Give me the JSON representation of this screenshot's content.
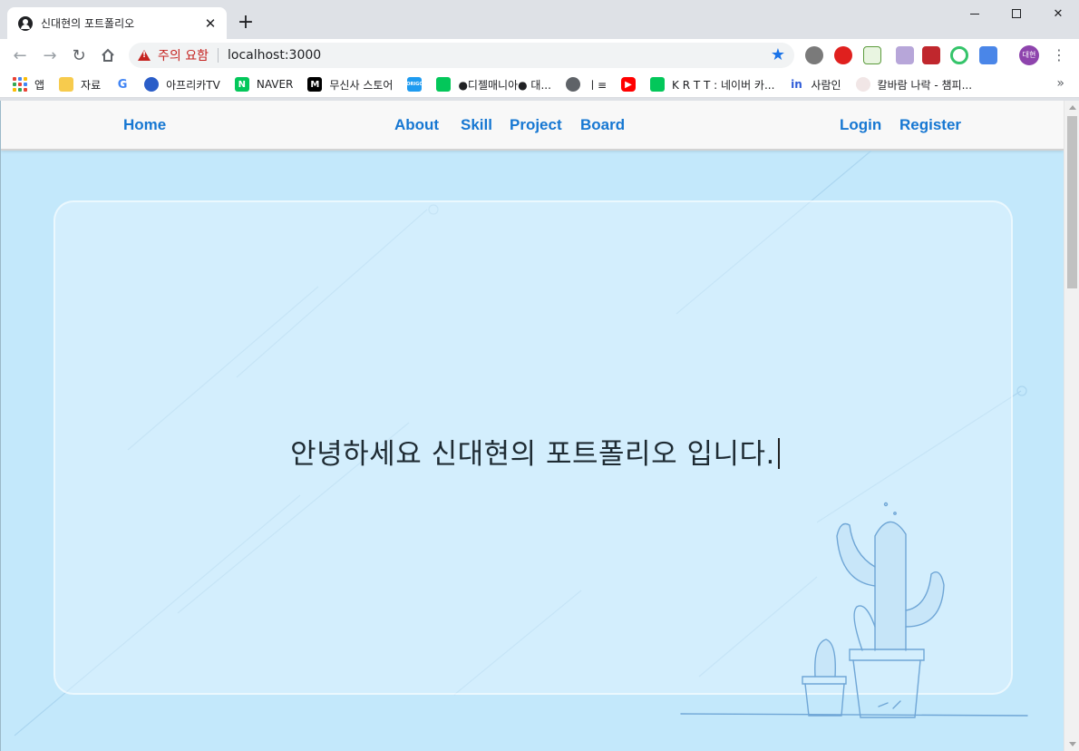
{
  "browser": {
    "tab_title": "신대현의 포트폴리오",
    "tab_close": "✕",
    "new_tab": "+",
    "security_warning": "주의 요함",
    "url": "localhost:3000",
    "profile_initials": "대현",
    "bookmarks": [
      {
        "label": "앱",
        "icon": "apps-grid-icon"
      },
      {
        "label": "자료",
        "icon": "folder-icon"
      },
      {
        "label": "",
        "icon": "google-icon"
      },
      {
        "label": "아프리카TV",
        "icon": "afreecatv-icon"
      },
      {
        "label": "NAVER",
        "icon": "naver-icon"
      },
      {
        "label": "무신사 스토어",
        "icon": "musinsa-icon"
      },
      {
        "label": "",
        "icon": "oroo-icon"
      },
      {
        "label": "●디젤매니아● 대...",
        "icon": "naver-cafe-icon"
      },
      {
        "label": "ㅣ≡",
        "icon": "globe-icon"
      },
      {
        "label": "",
        "icon": "youtube-icon"
      },
      {
        "label": "K R T T : 네이버 카...",
        "icon": "naver-cafe-icon"
      },
      {
        "label": "사람인",
        "icon": "saramin-icon"
      },
      {
        "label": "칼바람 나락 - 챔피...",
        "icon": "poro-icon"
      }
    ],
    "bookmarks_more": "»"
  },
  "site_nav": {
    "home": "Home",
    "about": "About",
    "skill": "Skill",
    "project": "Project",
    "board": "Board",
    "login": "Login",
    "register": "Register"
  },
  "hero": {
    "text": "안녕하세요 신대현의 포트폴리오 입니다."
  },
  "colors": {
    "nav_link": "#1677d2",
    "page_bg": "#c3e8fb",
    "warning": "#c5221f",
    "accent": "#1a73e8"
  }
}
